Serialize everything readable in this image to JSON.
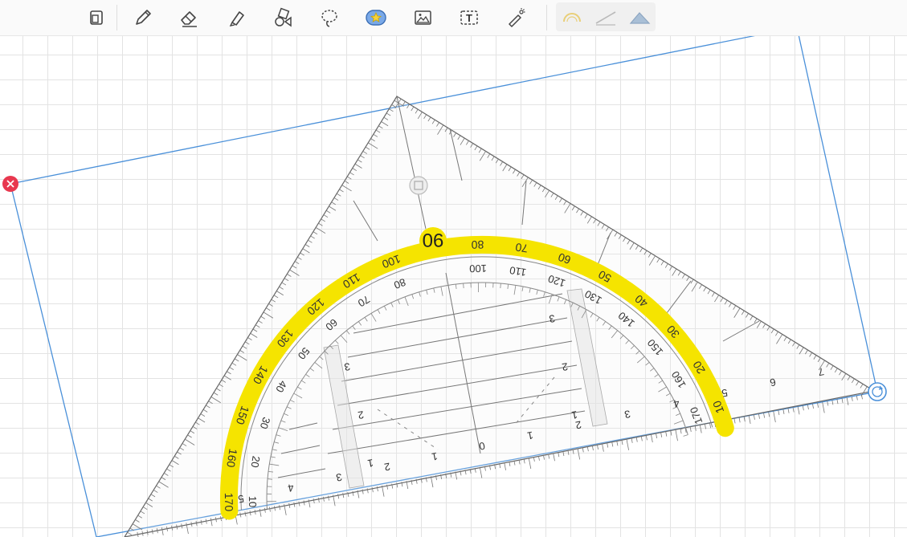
{
  "toolbar": {
    "items": [
      {
        "id": "page-view",
        "icon": "page-icon"
      },
      {
        "id": "pen",
        "icon": "pencil-icon"
      },
      {
        "id": "eraser",
        "icon": "eraser-icon"
      },
      {
        "id": "highlighter",
        "icon": "highlighter-icon"
      },
      {
        "id": "shapes",
        "icon": "shapes-icon"
      },
      {
        "id": "lasso",
        "icon": "lasso-icon"
      },
      {
        "id": "stickers",
        "icon": "star-sticker-icon",
        "active": true
      },
      {
        "id": "image",
        "icon": "image-icon"
      },
      {
        "id": "text",
        "icon": "text-box-icon"
      },
      {
        "id": "laser",
        "icon": "laser-pointer-icon"
      }
    ],
    "geometry_tools": [
      {
        "id": "protractor",
        "icon": "protractor-icon"
      },
      {
        "id": "ruler",
        "icon": "ruler-icon"
      },
      {
        "id": "set-square",
        "icon": "set-square-icon",
        "active": true
      }
    ],
    "text_box_glyph": "T"
  },
  "set_square": {
    "current_angle": "90",
    "outer_scale": [
      "10",
      "20",
      "30",
      "40",
      "50",
      "60",
      "70",
      "80",
      "100",
      "110",
      "120",
      "130",
      "140",
      "150",
      "160",
      "170"
    ],
    "inner_scale": [
      "170",
      "160",
      "150",
      "140",
      "130",
      "120",
      "110",
      "100",
      "80",
      "70",
      "60",
      "50",
      "40",
      "30",
      "20",
      "10"
    ],
    "edge_scale": [
      "5",
      "4",
      "3",
      "2",
      "1",
      "0",
      "1",
      "2",
      "3",
      "4",
      "5",
      "6",
      "7"
    ],
    "grid_labels": [
      "1",
      "2",
      "3",
      "1",
      "2",
      "3"
    ],
    "colors": {
      "highlight": "#f5e400",
      "selection": "#4a90d9",
      "delete": "#e8384f"
    }
  }
}
